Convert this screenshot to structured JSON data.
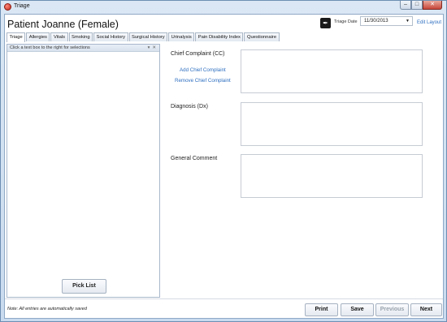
{
  "window": {
    "title": "Triage",
    "minimize": "–",
    "maximize": "□",
    "close": "✕"
  },
  "patient": {
    "title": "Patient Joanne (Female)"
  },
  "header": {
    "triage_date_label": "Triage Date",
    "triage_date_value": "11/30/2013",
    "edit_layout": "Edit Layout",
    "quill_glyph": "✒",
    "dropdown_glyph": "▼"
  },
  "tabs": [
    {
      "label": "Triage"
    },
    {
      "label": "Allergies"
    },
    {
      "label": "Vitals"
    },
    {
      "label": "Smoking"
    },
    {
      "label": "Social History"
    },
    {
      "label": "Surgical History"
    },
    {
      "label": "Urinalysis"
    },
    {
      "label": "Pain Disability Index"
    },
    {
      "label": "Questionnaire"
    }
  ],
  "left_panel": {
    "hint": "Click a text box to the right for selections",
    "pin_glyph": "▾",
    "close_glyph": "✕",
    "pick_list": "Pick List"
  },
  "fields": {
    "chief_complaint": "Chief Complaint (CC)",
    "add_chief_complaint": "Add Chief Complaint",
    "remove_chief_complaint": "Remove Chief Complaint",
    "diagnosis": "Diagnosis (Dx)",
    "general_comment": "General Comment"
  },
  "footer": {
    "note": "Note: All entries are automatically saved",
    "print": "Print",
    "save": "Save",
    "previous": "Previous",
    "next": "Next"
  }
}
